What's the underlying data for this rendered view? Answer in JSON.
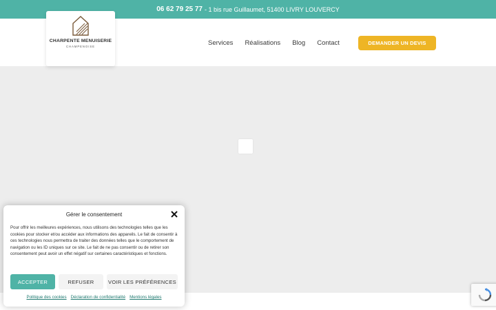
{
  "topbar": {
    "phone": "06 62 79 25 77",
    "address": "- 1 bis rue Guillaumet, 51400 LIVRY LOUVERCY"
  },
  "logo": {
    "title": "CHARPENTE MENUISERIE",
    "subtitle": "CHAMPENOISE"
  },
  "nav": {
    "items": [
      "Services",
      "Réalisations",
      "Blog",
      "Contact"
    ],
    "cta": "DEMANDER UN DEVIS"
  },
  "consent": {
    "title": "Gérer le consentement",
    "text": "Pour offrir les meilleures expériences, nous utilisons des technologies telles que les cookies pour stocker et/ou accéder aux informations des appareils. Le fait de consentir à ces technologies nous permettra de traiter des données telles que le comportement de navigation ou les ID uniques sur ce site. Le fait de ne pas consentir ou de retirer son consentement peut avoir un effet négatif sur certaines caractéristiques et fonctions.",
    "accept": "ACCEPTER",
    "refuse": "REFUSER",
    "preferences": "VOIR LES PRÉFÉRENCES",
    "links": [
      "Politique des cookies",
      "Déclaration de confidentialité",
      "Mentions légales"
    ]
  },
  "colors": {
    "brand_teal": "#4fb3a6",
    "cta_yellow": "#eeb525"
  }
}
